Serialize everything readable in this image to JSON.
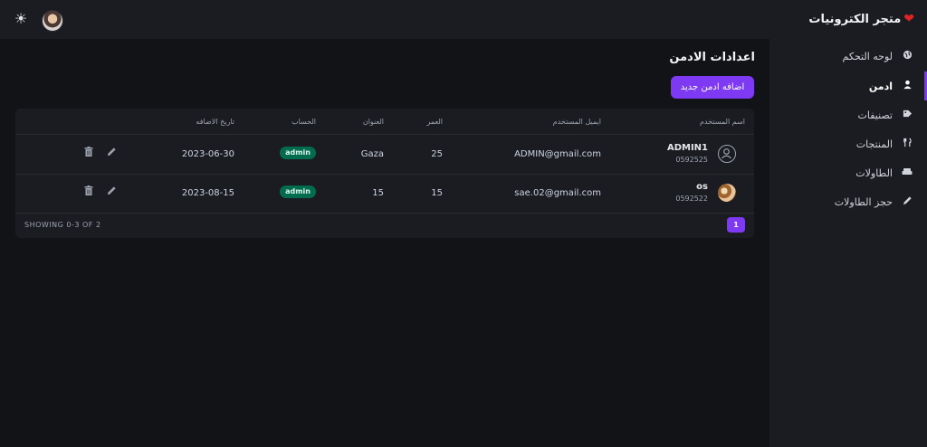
{
  "header": {
    "brand_name": "متجر الكترونيات",
    "theme_icon": "sun-icon",
    "avatar": "user-avatar-photo"
  },
  "sidebar": {
    "items": [
      {
        "label": "لوحه التحكم",
        "icon": "globe-icon",
        "active": false
      },
      {
        "label": "ادمن",
        "icon": "user-icon",
        "active": true
      },
      {
        "label": "تصنيفات",
        "icon": "tag-icon",
        "active": false
      },
      {
        "label": "المنتجات",
        "icon": "utensils-icon",
        "active": false
      },
      {
        "label": "الطاولات",
        "icon": "sofa-icon",
        "active": false
      },
      {
        "label": "حجز الطاولات",
        "icon": "pencil-icon",
        "active": false
      }
    ]
  },
  "main": {
    "title": "اعدادات الادمن",
    "add_button": "اضافه ادمن جديد"
  },
  "table": {
    "headers": {
      "user": "اسم المستخدم",
      "email": "ايميل المستخدم",
      "age": "العمر",
      "address": "العنوان",
      "account": "الحساب",
      "date": "تاريخ الاضافه"
    },
    "rows": [
      {
        "name": "ADMIN1",
        "phone": "0592525",
        "email": "ADMIN@gmail.com",
        "age": "25",
        "address": "Gaza",
        "account": "admin",
        "date": "2023-06-30"
      },
      {
        "name": "os",
        "phone": "0592522",
        "email": "sae.02@gmail.com",
        "age": "15",
        "address": "15",
        "account": "admin",
        "date": "2023-08-15"
      }
    ],
    "showing": "SHOWING 0-3 OF 2",
    "current_page": "1"
  },
  "colors": {
    "accent": "#7e3af2",
    "badge": "#046c4e",
    "heart": "#e02424"
  }
}
